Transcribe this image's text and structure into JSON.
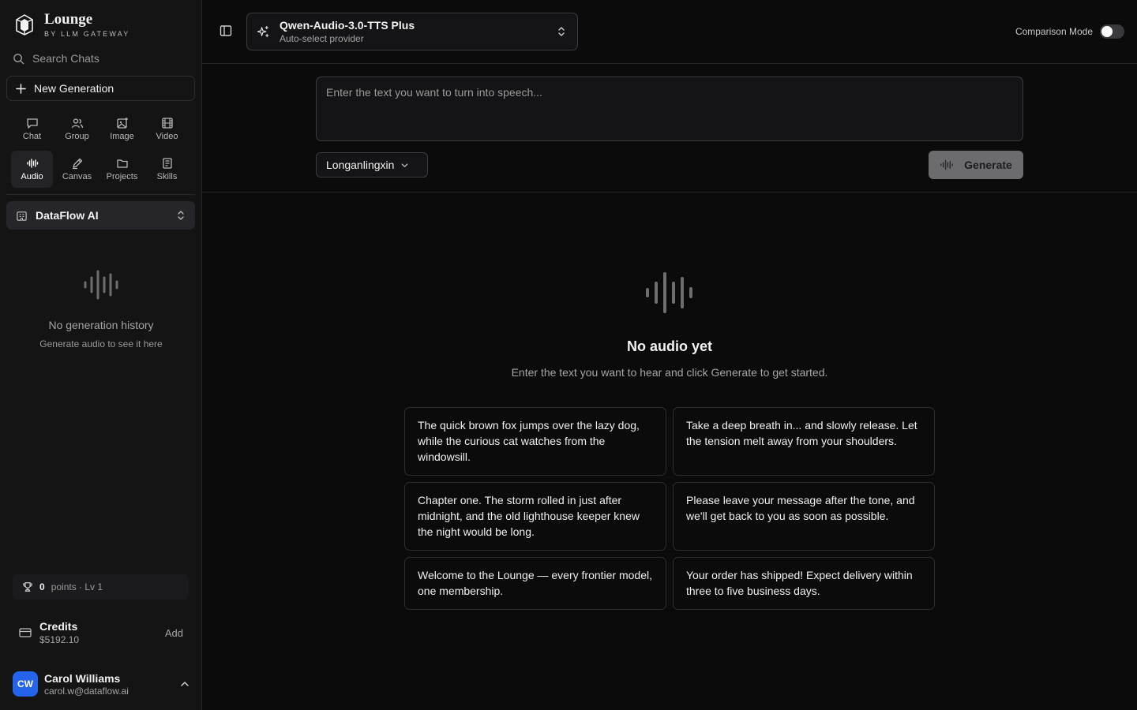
{
  "brand": {
    "name": "Lounge",
    "sub": "BY LLM GATEWAY"
  },
  "sidebar": {
    "search_label": "Search Chats",
    "new_generation": "New Generation",
    "modes": [
      {
        "label": "Chat",
        "icon": "chat-icon"
      },
      {
        "label": "Group",
        "icon": "group-icon"
      },
      {
        "label": "Image",
        "icon": "image-icon"
      },
      {
        "label": "Video",
        "icon": "video-icon"
      },
      {
        "label": "Audio",
        "icon": "audio-icon",
        "active": true
      },
      {
        "label": "Canvas",
        "icon": "canvas-icon"
      },
      {
        "label": "Projects",
        "icon": "folder-icon"
      },
      {
        "label": "Skills",
        "icon": "skills-icon"
      }
    ],
    "org_name": "DataFlow AI",
    "history_empty_title": "No generation history",
    "history_empty_sub": "Generate audio to see it here",
    "points": {
      "value": "0",
      "label": "points · Lv 1"
    },
    "credits": {
      "label": "Credits",
      "amount": "$5192.10",
      "add": "Add"
    },
    "user": {
      "initials": "CW",
      "name": "Carol Williams",
      "email": "carol.w@dataflow.ai",
      "avatar_color": "#2563eb"
    }
  },
  "topbar": {
    "model_name": "Qwen-Audio-3.0-TTS Plus",
    "model_sub": "Auto-select provider",
    "comparison_label": "Comparison Mode",
    "comparison_on": false
  },
  "composer": {
    "placeholder": "Enter the text you want to turn into speech...",
    "value": "",
    "voice": "Longanlingxin",
    "generate": "Generate"
  },
  "empty_state": {
    "title": "No audio yet",
    "subtitle": "Enter the text you want to hear and click Generate to get started."
  },
  "prompts": [
    "The quick brown fox jumps over the lazy dog, while the curious cat watches from the windowsill.",
    "Take a deep breath in... and slowly release. Let the tension melt away from your shoulders.",
    "Chapter one. The storm rolled in just after midnight, and the old lighthouse keeper knew the night would be long.",
    "Please leave your message after the tone, and we'll get back to you as soon as possible.",
    "Welcome to the Lounge — every frontier model, one membership.",
    "Your order has shipped! Expect delivery within three to five business days."
  ]
}
